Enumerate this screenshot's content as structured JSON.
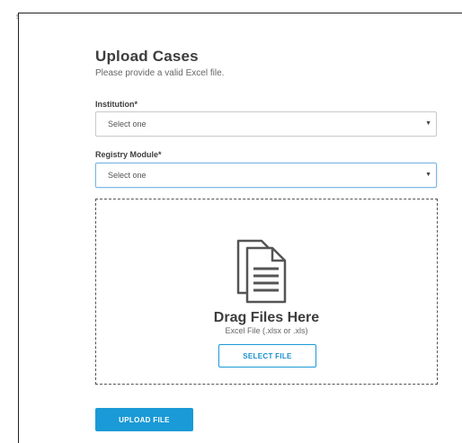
{
  "page": {
    "corner_mark": "s",
    "title": "Upload Cases",
    "subtitle": "Please provide a valid Excel file."
  },
  "form": {
    "institution": {
      "label": "Institution*",
      "value": "Select one",
      "arrow_icon": "dropdown-arrow-icon"
    },
    "registry_module": {
      "label": "Registry Module*",
      "value": "Select one",
      "arrow_icon": "dropdown-arrow-icon",
      "focused": true
    }
  },
  "dropzone": {
    "icon": "documents-icon",
    "title": "Drag Files Here",
    "subtitle": "Excel File (.xlsx or .xls)",
    "select_file_label": "SELECT FILE"
  },
  "actions": {
    "upload_label": "UPLOAD FILE"
  },
  "colors": {
    "accent": "#1a9ad6",
    "focus_border": "#7cb7e6",
    "text_dark": "#3d3d3d",
    "icon_gray": "#555555"
  }
}
